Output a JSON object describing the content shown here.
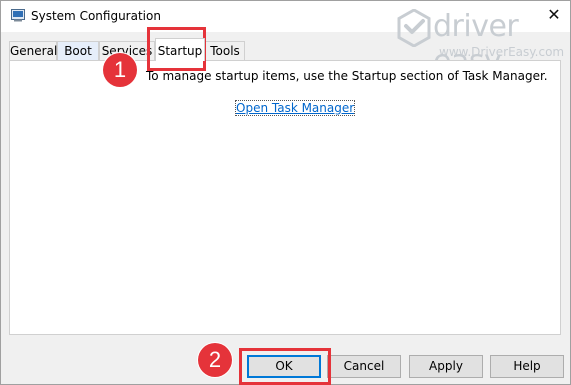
{
  "window": {
    "title": "System Configuration",
    "close_glyph": "✕"
  },
  "tabs": [
    {
      "label": "General",
      "selected": false
    },
    {
      "label": "Boot",
      "selected": false
    },
    {
      "label": "Services",
      "selected": false
    },
    {
      "label": "Startup",
      "selected": true
    },
    {
      "label": "Tools",
      "selected": false
    }
  ],
  "startup": {
    "info_text": "To manage startup items, use the Startup section of Task Manager.",
    "link_text": "Open Task Manager"
  },
  "buttons": {
    "ok": "OK",
    "cancel": "Cancel",
    "apply": "Apply",
    "help": "Help"
  },
  "annotations": {
    "marker1": "1",
    "marker2": "2",
    "highlight_color": "#e5333a"
  },
  "watermark": {
    "brand": "driver easy",
    "url": "www.DriverEasy.com",
    "color": "#c8cdd2"
  },
  "colors": {
    "link": "#0066cc",
    "ok_border": "#0078d7"
  }
}
